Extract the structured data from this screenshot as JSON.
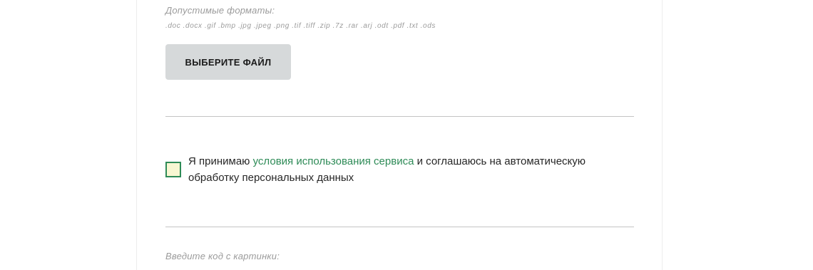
{
  "upload": {
    "formats_label": "Допустимые форматы:",
    "formats_list": ".doc .docx .gif .bmp .jpg .jpeg .png .tif .tiff .zip .7z .rar .arj .odt .pdf .txt .ods",
    "button_label": "ВЫБЕРИТЕ ФАЙЛ"
  },
  "consent": {
    "checked": false,
    "text_before": "Я принимаю ",
    "link_text": "условия использования сервиса",
    "text_after": " и соглашаюсь на автоматическую обработку персональных данных"
  },
  "captcha": {
    "label": "Введите код с картинки:"
  },
  "colors": {
    "accent": "#2e8b57",
    "checkbox_fill": "#f8f7d2",
    "button_bg": "#d6d9da",
    "hint_text": "#9b9b9b"
  }
}
